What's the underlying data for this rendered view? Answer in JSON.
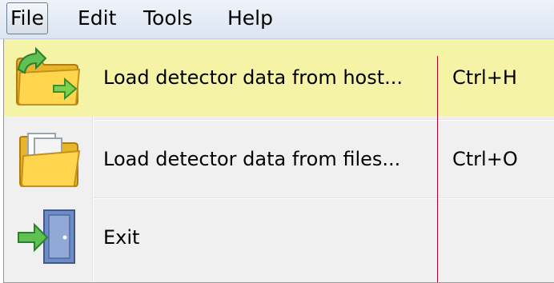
{
  "menubar": {
    "items": [
      {
        "label": "File",
        "active": true
      },
      {
        "label": "Edit",
        "active": false
      },
      {
        "label": "Tools",
        "active": false
      },
      {
        "label": "Help",
        "active": false
      }
    ]
  },
  "file_menu": {
    "items": [
      {
        "label": "Load detector data from host...",
        "shortcut": "Ctrl+H",
        "icon": "folder-load-host-icon",
        "highlighted": true
      },
      {
        "label": "Load detector data from files...",
        "shortcut": "Ctrl+O",
        "icon": "folder-open-files-icon",
        "highlighted": false
      },
      {
        "label": "Exit",
        "shortcut": "",
        "icon": "exit-door-icon",
        "highlighted": false
      }
    ]
  },
  "colors": {
    "highlight": "#f5f3a6",
    "menu_background": "#f0f0f0",
    "menubar_background": "#dbe5f2",
    "guide_line": "#c0002a"
  }
}
